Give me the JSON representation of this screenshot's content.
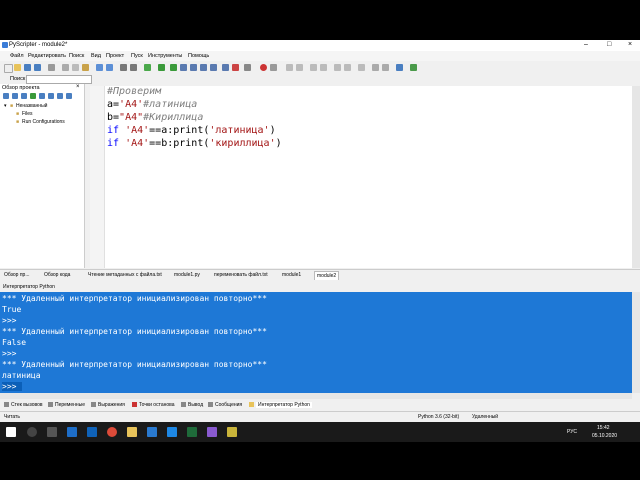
{
  "window": {
    "title": "PyScripter - module2*"
  },
  "menu": [
    "Файл",
    "Редактировать",
    "Поиск",
    "Вид",
    "Проект",
    "Пуск",
    "Инструменты",
    "Помощь"
  ],
  "search": {
    "label": "Поиск"
  },
  "project": {
    "title": "Обзор проекта",
    "close": "×",
    "tree": [
      "Неназванный",
      "Files",
      "Run Configurations"
    ]
  },
  "editor": {
    "lines": {
      "l1": "#Проверим",
      "l2a": "a=",
      "l2b": "'A4'",
      "l2c": "#латиница",
      "l3a": "b=",
      "l3b": "\"A4\"",
      "l3c": "#Кириллица",
      "l4a": "if ",
      "l4b": "'A4'",
      "l4c": "==a:print(",
      "l4d": "'латиница'",
      "l4e": ")",
      "l5a": "if ",
      "l5b": "'A4'",
      "l5c": "==b:print(",
      "l5d": "'кириллица'",
      "l5e": ")"
    }
  },
  "tabs": [
    "Обзор пр...",
    "Обзор кода",
    "Чтение метаданных с файла.txt",
    "module1.py",
    "переменовать файл.txt",
    "module1",
    "module2"
  ],
  "interpreter": {
    "title": "Интерпретатор Python",
    "lines": [
      "*** Удаленный интерпретатор инициализирован повторно***",
      "True",
      ">>>",
      "*** Удаленный интерпретатор инициализирован повторно***",
      "False",
      ">>>",
      "*** Удаленный интерпретатор инициализирован повторно***",
      "латиница",
      ">>>"
    ]
  },
  "bottom_tabs": [
    "Стек вызовов",
    "Переменные",
    "Выражения",
    "Точки останова",
    "Вывод",
    "Сообщения",
    "Интерпретатор Python"
  ],
  "status": {
    "left": "Читать",
    "python": "Python 3.6 (32-bit)",
    "mode": "Удаленный"
  },
  "taskbar": {
    "time": "15:42",
    "date": "05.10.2020",
    "lang": "РУС"
  },
  "colors": {
    "console_bg": "#1e78d6",
    "keyword": "#0000ff",
    "string": "#a31515",
    "comment": "#7f7f7f"
  }
}
